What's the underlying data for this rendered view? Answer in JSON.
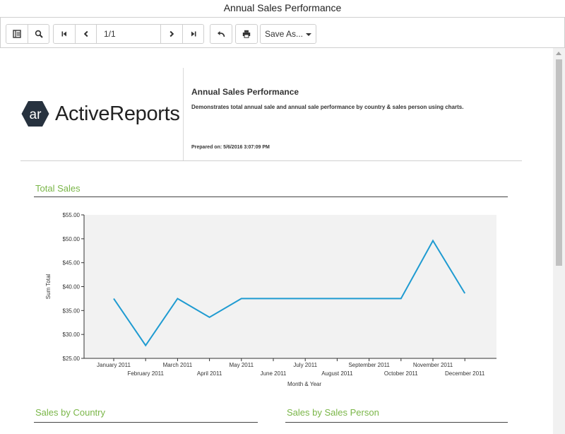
{
  "window": {
    "title": "Annual Sales Performance"
  },
  "toolbar": {
    "page_value": "1/1",
    "save_as_label": "Save As..."
  },
  "report": {
    "logo_text": "ActiveReports",
    "logo_mark": "ar",
    "title": "Annual Sales Performance",
    "description": "Demonstrates total annual sale and annual sale performance  by country & sales person using charts.",
    "prepared": "Prepared on: 5/6/2016 3:07:09 PM"
  },
  "sections": {
    "total_sales": "Total Sales",
    "by_country": "Sales by Country",
    "by_sales_person": "Sales by Sales Person"
  },
  "colors": {
    "accent_green": "#7ab648",
    "line_blue": "#1f9bd1",
    "plot_bg": "#f2f2f2",
    "logo_hex": "#27323f"
  },
  "chart_data": {
    "type": "line",
    "title": "Total Sales",
    "xlabel": "Month & Year",
    "ylabel": "Sum Total",
    "ylim": [
      25,
      55
    ],
    "y_ticks": [
      "$25.00",
      "$30.00",
      "$35.00",
      "$40.00",
      "$45.00",
      "$50.00",
      "$55.00"
    ],
    "categories": [
      "January 2011",
      "February 2011",
      "March 2011",
      "April 2011",
      "May 2011",
      "June 2011",
      "July 2011",
      "August 2011",
      "September 2011",
      "October 2011",
      "November 2011",
      "December 2011"
    ],
    "values": [
      37.5,
      27.7,
      37.5,
      33.6,
      37.5,
      37.5,
      37.5,
      37.5,
      37.5,
      37.5,
      49.6,
      38.6
    ],
    "grid": false,
    "legend": "none"
  }
}
